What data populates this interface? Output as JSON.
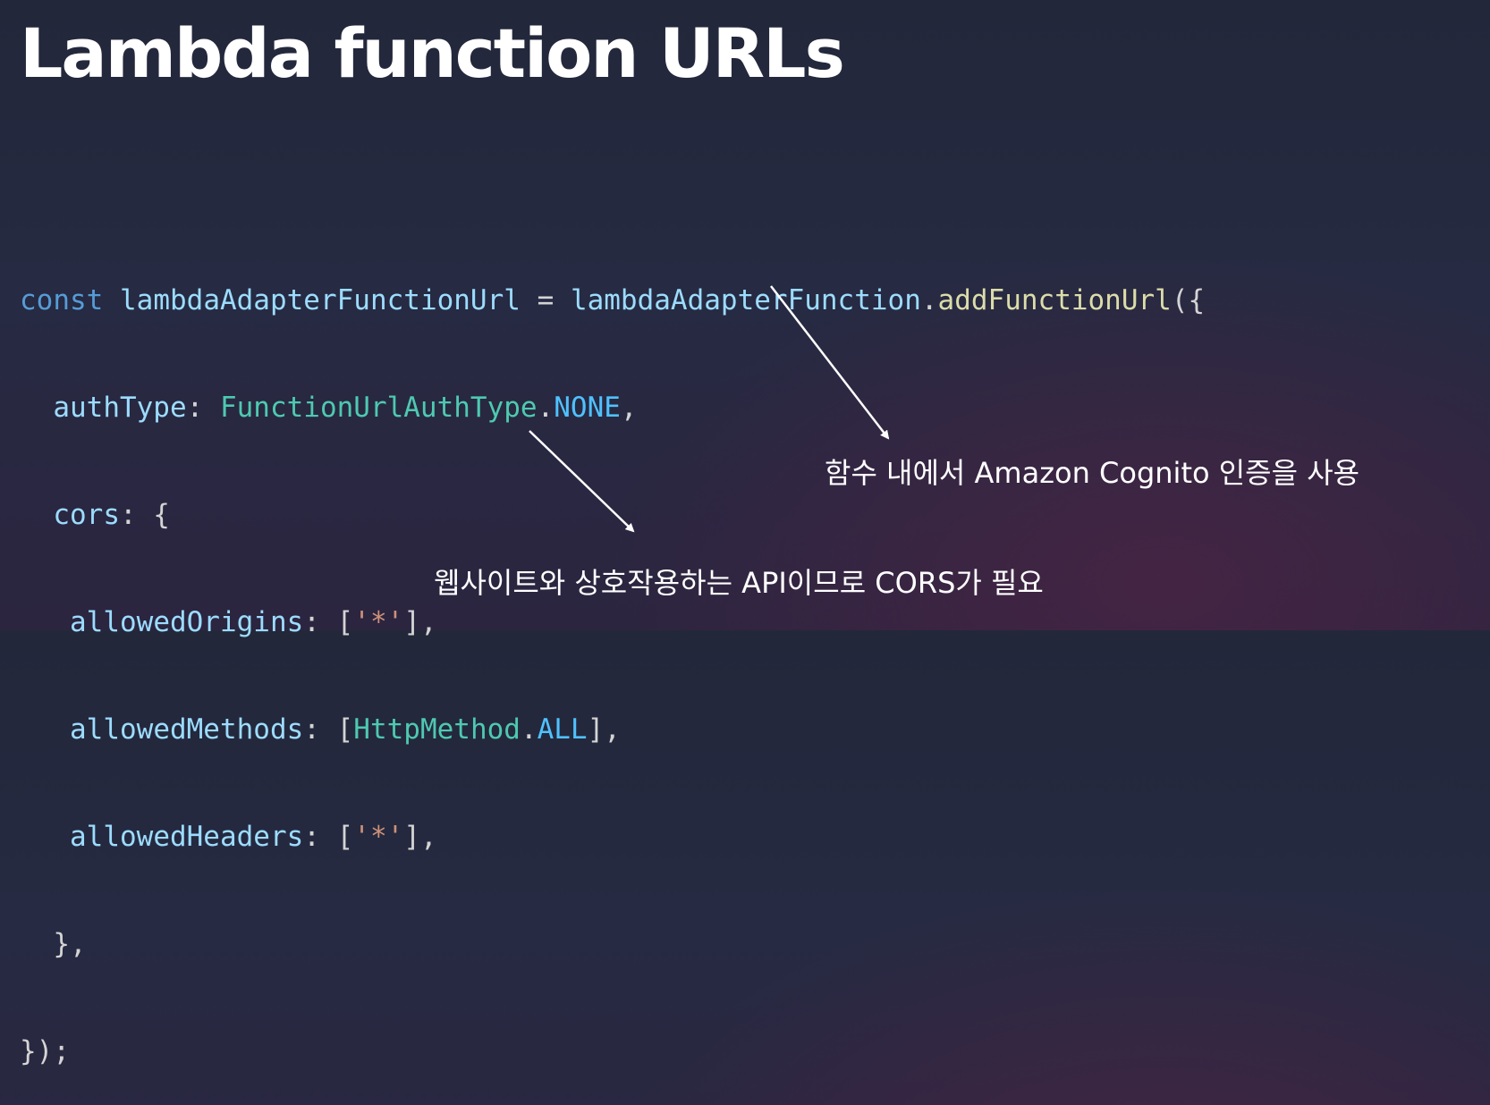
{
  "slide": {
    "title": "Lambda function URLs"
  },
  "code": {
    "line1": {
      "const": "const",
      "var": "lambdaAdapterFunctionUrl",
      "eq": " = ",
      "obj": "lambdaAdapterFunction",
      "dot": ".",
      "method": "addFunctionUrl",
      "open": "({"
    },
    "line2": {
      "key": "authType",
      "colon": ": ",
      "type": "FunctionUrlAuthType",
      "dot": ".",
      "const": "NONE",
      "comma": ","
    },
    "line3": {
      "key": "cors",
      "rest": ": {"
    },
    "line4": {
      "key": "allowedOrigins",
      "colon": ": [",
      "str": "'*'",
      "close": "],"
    },
    "line5": {
      "key": "allowedMethods",
      "colon": ": [",
      "type": "HttpMethod",
      "dot": ".",
      "const": "ALL",
      "close": "],"
    },
    "line6": {
      "key": "allowedHeaders",
      "colon": ": [",
      "str": "'*'",
      "close": "],"
    },
    "line7": "},",
    "line8": "});"
  },
  "annotations": {
    "auth": "함수 내에서 Amazon Cognito 인증을 사용",
    "cors": "웹사이트와 상호작용하는 API이므로 CORS가 필요"
  },
  "colors": {
    "keyword": "#569cd6",
    "identifier": "#9cdcfe",
    "function": "#dcdcaa",
    "type": "#4ec9b0",
    "constant": "#4fc1ff",
    "string": "#ce9178",
    "title": "#ffffff"
  }
}
